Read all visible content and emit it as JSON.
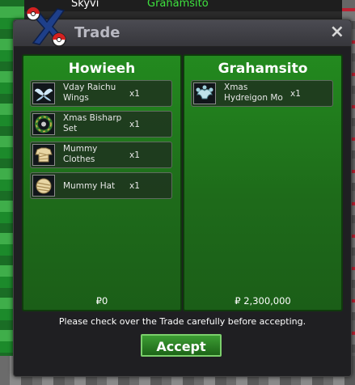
{
  "background": {
    "player_names": [
      "Skyvi",
      "Grahamsito"
    ]
  },
  "window": {
    "title": "Trade",
    "close_label": "×",
    "notice": "Please check over the Trade carefully before accepting.",
    "accept_label": "Accept"
  },
  "left": {
    "name": "Howieeh",
    "money": "₽0",
    "items": [
      {
        "name": "Vday Raichu Wings",
        "qty": "x1",
        "icon": "wings-icon"
      },
      {
        "name": "Xmas Bisharp Set",
        "qty": "x1",
        "icon": "wreath-icon"
      },
      {
        "name": "Mummy Clothes",
        "qty": "x1",
        "icon": "mummy-clothes-icon"
      },
      {
        "name": "Mummy Hat",
        "qty": "x1",
        "icon": "mummy-hat-icon"
      }
    ]
  },
  "right": {
    "name": "Grahamsito",
    "money": "₽ 2,300,000",
    "items": [
      {
        "name": "Xmas Hydreigon Mo",
        "qty": "x1",
        "icon": "dragon-mount-icon"
      }
    ]
  },
  "colors": {
    "panel_green": "#238a1f",
    "button_green": "#3c9d33",
    "player_name_green": "#3ee23e"
  }
}
